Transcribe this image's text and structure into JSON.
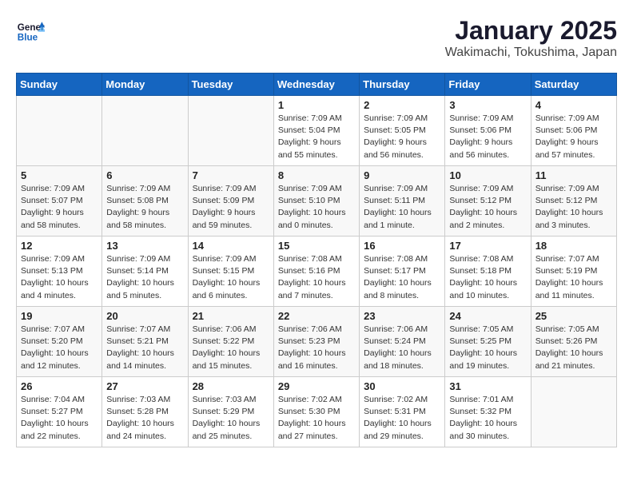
{
  "header": {
    "logo_general": "General",
    "logo_blue": "Blue",
    "month": "January 2025",
    "location": "Wakimachi, Tokushima, Japan"
  },
  "weekdays": [
    "Sunday",
    "Monday",
    "Tuesday",
    "Wednesday",
    "Thursday",
    "Friday",
    "Saturday"
  ],
  "weeks": [
    [
      {
        "day": "",
        "info": ""
      },
      {
        "day": "",
        "info": ""
      },
      {
        "day": "",
        "info": ""
      },
      {
        "day": "1",
        "info": "Sunrise: 7:09 AM\nSunset: 5:04 PM\nDaylight: 9 hours\nand 55 minutes."
      },
      {
        "day": "2",
        "info": "Sunrise: 7:09 AM\nSunset: 5:05 PM\nDaylight: 9 hours\nand 56 minutes."
      },
      {
        "day": "3",
        "info": "Sunrise: 7:09 AM\nSunset: 5:06 PM\nDaylight: 9 hours\nand 56 minutes."
      },
      {
        "day": "4",
        "info": "Sunrise: 7:09 AM\nSunset: 5:06 PM\nDaylight: 9 hours\nand 57 minutes."
      }
    ],
    [
      {
        "day": "5",
        "info": "Sunrise: 7:09 AM\nSunset: 5:07 PM\nDaylight: 9 hours\nand 58 minutes."
      },
      {
        "day": "6",
        "info": "Sunrise: 7:09 AM\nSunset: 5:08 PM\nDaylight: 9 hours\nand 58 minutes."
      },
      {
        "day": "7",
        "info": "Sunrise: 7:09 AM\nSunset: 5:09 PM\nDaylight: 9 hours\nand 59 minutes."
      },
      {
        "day": "8",
        "info": "Sunrise: 7:09 AM\nSunset: 5:10 PM\nDaylight: 10 hours\nand 0 minutes."
      },
      {
        "day": "9",
        "info": "Sunrise: 7:09 AM\nSunset: 5:11 PM\nDaylight: 10 hours\nand 1 minute."
      },
      {
        "day": "10",
        "info": "Sunrise: 7:09 AM\nSunset: 5:12 PM\nDaylight: 10 hours\nand 2 minutes."
      },
      {
        "day": "11",
        "info": "Sunrise: 7:09 AM\nSunset: 5:12 PM\nDaylight: 10 hours\nand 3 minutes."
      }
    ],
    [
      {
        "day": "12",
        "info": "Sunrise: 7:09 AM\nSunset: 5:13 PM\nDaylight: 10 hours\nand 4 minutes."
      },
      {
        "day": "13",
        "info": "Sunrise: 7:09 AM\nSunset: 5:14 PM\nDaylight: 10 hours\nand 5 minutes."
      },
      {
        "day": "14",
        "info": "Sunrise: 7:09 AM\nSunset: 5:15 PM\nDaylight: 10 hours\nand 6 minutes."
      },
      {
        "day": "15",
        "info": "Sunrise: 7:08 AM\nSunset: 5:16 PM\nDaylight: 10 hours\nand 7 minutes."
      },
      {
        "day": "16",
        "info": "Sunrise: 7:08 AM\nSunset: 5:17 PM\nDaylight: 10 hours\nand 8 minutes."
      },
      {
        "day": "17",
        "info": "Sunrise: 7:08 AM\nSunset: 5:18 PM\nDaylight: 10 hours\nand 10 minutes."
      },
      {
        "day": "18",
        "info": "Sunrise: 7:07 AM\nSunset: 5:19 PM\nDaylight: 10 hours\nand 11 minutes."
      }
    ],
    [
      {
        "day": "19",
        "info": "Sunrise: 7:07 AM\nSunset: 5:20 PM\nDaylight: 10 hours\nand 12 minutes."
      },
      {
        "day": "20",
        "info": "Sunrise: 7:07 AM\nSunset: 5:21 PM\nDaylight: 10 hours\nand 14 minutes."
      },
      {
        "day": "21",
        "info": "Sunrise: 7:06 AM\nSunset: 5:22 PM\nDaylight: 10 hours\nand 15 minutes."
      },
      {
        "day": "22",
        "info": "Sunrise: 7:06 AM\nSunset: 5:23 PM\nDaylight: 10 hours\nand 16 minutes."
      },
      {
        "day": "23",
        "info": "Sunrise: 7:06 AM\nSunset: 5:24 PM\nDaylight: 10 hours\nand 18 minutes."
      },
      {
        "day": "24",
        "info": "Sunrise: 7:05 AM\nSunset: 5:25 PM\nDaylight: 10 hours\nand 19 minutes."
      },
      {
        "day": "25",
        "info": "Sunrise: 7:05 AM\nSunset: 5:26 PM\nDaylight: 10 hours\nand 21 minutes."
      }
    ],
    [
      {
        "day": "26",
        "info": "Sunrise: 7:04 AM\nSunset: 5:27 PM\nDaylight: 10 hours\nand 22 minutes."
      },
      {
        "day": "27",
        "info": "Sunrise: 7:03 AM\nSunset: 5:28 PM\nDaylight: 10 hours\nand 24 minutes."
      },
      {
        "day": "28",
        "info": "Sunrise: 7:03 AM\nSunset: 5:29 PM\nDaylight: 10 hours\nand 25 minutes."
      },
      {
        "day": "29",
        "info": "Sunrise: 7:02 AM\nSunset: 5:30 PM\nDaylight: 10 hours\nand 27 minutes."
      },
      {
        "day": "30",
        "info": "Sunrise: 7:02 AM\nSunset: 5:31 PM\nDaylight: 10 hours\nand 29 minutes."
      },
      {
        "day": "31",
        "info": "Sunrise: 7:01 AM\nSunset: 5:32 PM\nDaylight: 10 hours\nand 30 minutes."
      },
      {
        "day": "",
        "info": ""
      }
    ]
  ]
}
